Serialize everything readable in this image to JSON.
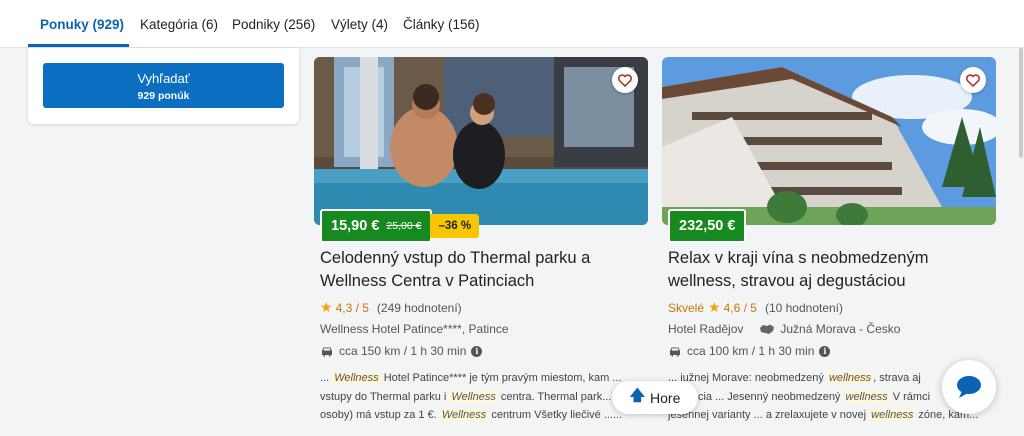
{
  "tabs": [
    {
      "label": "Ponuky (929)",
      "active": true
    },
    {
      "label": "Kategória (6)",
      "active": false
    },
    {
      "label": "Podniky (256)",
      "active": false
    },
    {
      "label": "Výlety (4)",
      "active": false
    },
    {
      "label": "Články (156)",
      "active": false
    }
  ],
  "search": {
    "button_label": "Vyhľadať",
    "count_label": "929 ponúk"
  },
  "cards": [
    {
      "price": "15,90 €",
      "old_price": "25,00 €",
      "discount": "–36 %",
      "title": "Celodenný vstup do Thermal parku a Wellness Centra v Patinciach",
      "rating_quality": "",
      "rating_score": "4,3 / 5",
      "rating_count": "(249 hodnotení)",
      "venue": "Wellness Hotel Patince****, Patince",
      "region": "",
      "distance": "cca 150 km / 1 h 30 min",
      "snippet": [
        [
          "... ",
          "Wellness",
          " Hotel Patince**** je tým pravým miestom, kam ..."
        ],
        [
          "vstupy do Thermal parku i ",
          "Wellness",
          " centra. Thermal park..."
        ],
        [
          "osoby) má vstup za 1 €. ",
          "Wellness",
          " centrum Všetky liečivé ......"
        ]
      ]
    },
    {
      "price": "232,50 €",
      "old_price": "",
      "discount": "",
      "title": "Relax v kraji vína s neobmedzeným wellness, stravou aj degustáciou",
      "rating_quality": "Skvelé",
      "rating_score": "4,6 / 5",
      "rating_count": "(10 hodnotení)",
      "venue": "Hotel Radějov",
      "region": "Južná Morava - Česko",
      "distance": "cca 100 km / 1 h 30 min",
      "snippet": [
        [
          "... južnej Morave: neobmedzený ",
          "wellness",
          ", strava aj"
        ],
        [
          "...ustácia ... Jesenný neobmedzený ",
          "wellness",
          " V rámci"
        ],
        [
          "jesennej varianty ... a zrelaxujete v novej ",
          "wellness",
          " zóne, kam..."
        ]
      ]
    }
  ],
  "back_to_top": {
    "label": "Hore"
  },
  "colors": {
    "brand_blue": "#0b63b6",
    "price_green": "#16891f",
    "discount_yellow": "#f6c700",
    "rating_orange": "#c4790b"
  },
  "icons": [
    "heart-icon",
    "star-icon",
    "car-icon",
    "info-icon",
    "map-region-icon",
    "arrow-up-icon",
    "chat-icon"
  ]
}
